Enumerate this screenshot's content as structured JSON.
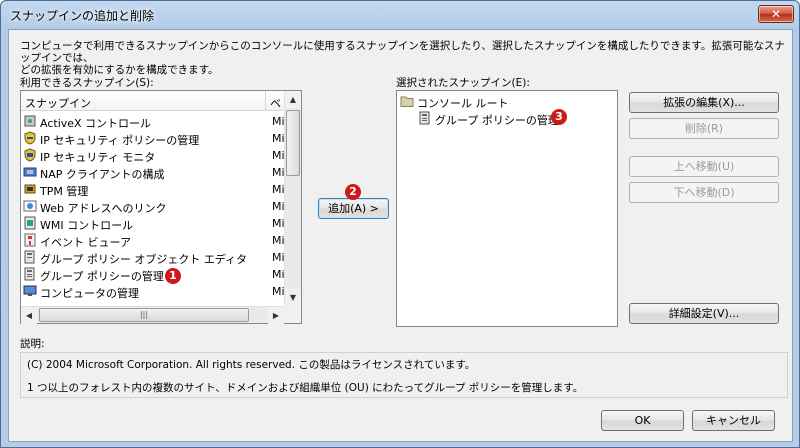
{
  "window": {
    "title": "スナップインの追加と削除",
    "close_label": "✕"
  },
  "description_lines": [
    "コンピュータで利用できるスナップインからこのコンソールに使用するスナップインを選択したり、選択したスナップインを構成したりできます。拡張可能なスナップインでは、",
    "どの拡張を有効にするかを構成できます。"
  ],
  "available": {
    "label": "利用できるスナップイン(S):",
    "columns": [
      "スナップイン",
      "ベ"
    ],
    "items": [
      {
        "name": "ActiveX コントロール",
        "vendor": "Mi",
        "icon": "activex-icon"
      },
      {
        "name": "IP セキュリティ ポリシーの管理",
        "vendor": "Mi",
        "icon": "ipsec-policy-icon"
      },
      {
        "name": "IP セキュリティ モニタ",
        "vendor": "Mi",
        "icon": "ipsec-monitor-icon"
      },
      {
        "name": "NAP クライアントの構成",
        "vendor": "Mi",
        "icon": "nap-icon"
      },
      {
        "name": "TPM 管理",
        "vendor": "Mi",
        "icon": "tpm-icon"
      },
      {
        "name": "Web アドレスへのリンク",
        "vendor": "Mi",
        "icon": "web-link-icon"
      },
      {
        "name": "WMI コントロール",
        "vendor": "Mi",
        "icon": "wmi-icon"
      },
      {
        "name": "イベント ビューア",
        "vendor": "Mi",
        "icon": "event-viewer-icon"
      },
      {
        "name": "グループ ポリシー オブジェクト エディタ",
        "vendor": "Mi",
        "icon": "gpo-editor-icon"
      },
      {
        "name": "グループ ポリシーの管理",
        "vendor": "Mi",
        "icon": "gp-management-icon"
      },
      {
        "name": "コンピュータの管理",
        "vendor": "Mi",
        "icon": "computer-management-icon"
      }
    ]
  },
  "add_button": "追加(A) >",
  "selected": {
    "label": "選択されたスナップイン(E):",
    "root": "コンソール ルート",
    "child": "グループ ポリシーの管理"
  },
  "buttons": {
    "edit_extensions": "拡張の編集(X)...",
    "remove": "削除(R)",
    "move_up": "上へ移動(U)",
    "move_down": "下へ移動(D)",
    "advanced": "詳細設定(V)...",
    "ok": "OK",
    "cancel": "キャンセル"
  },
  "info": {
    "label": "説明:",
    "line1": "(C) 2004 Microsoft Corporation. All rights reserved. この製品はライセンスされています。",
    "line2": "1 つ以上のフォレスト内の複数のサイト、ドメインおよび組織単位 (OU) にわたってグループ ポリシーを管理します。"
  },
  "badges": [
    "1",
    "2",
    "3"
  ]
}
